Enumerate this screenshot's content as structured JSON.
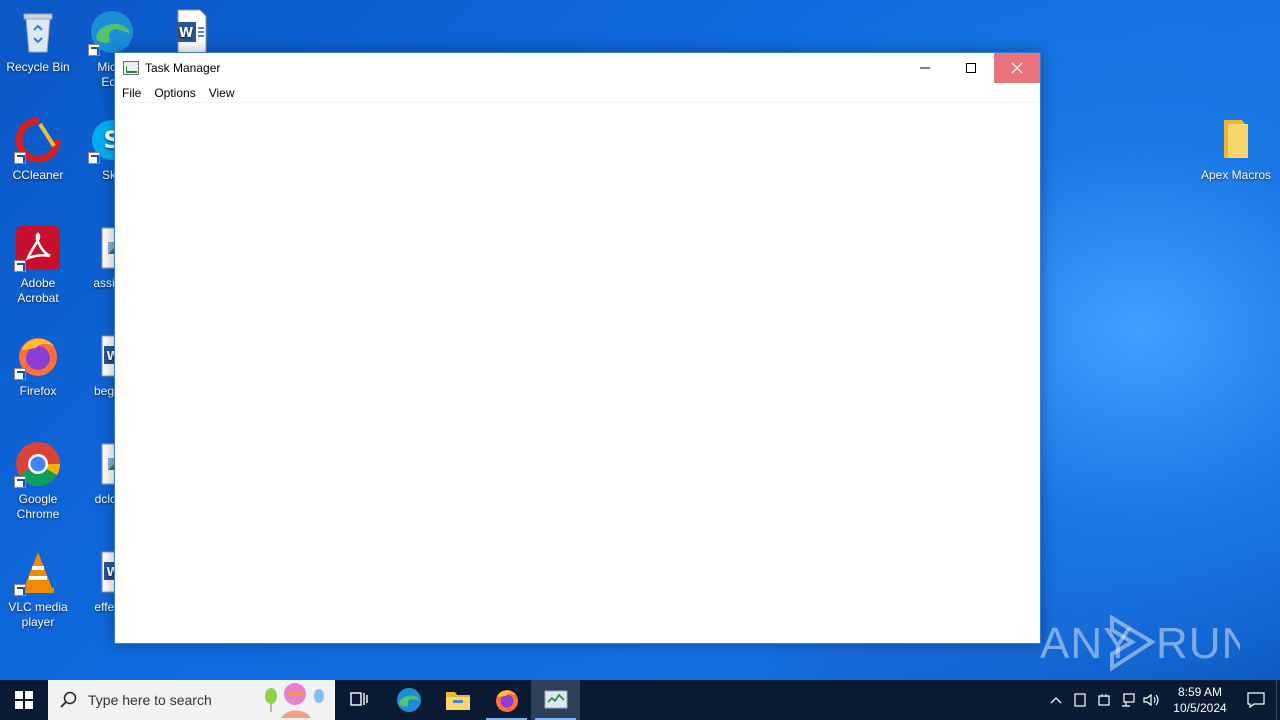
{
  "desktop": {
    "icons": [
      {
        "label": "Recycle Bin"
      },
      {
        "label": "Microsoft Edge",
        "visible_label": "Micro\nEdg"
      },
      {
        "label": "Word"
      },
      {
        "label": "CCleaner"
      },
      {
        "label": "Skype",
        "visible_label": "Sky"
      },
      {
        "label": "Adobe Acrobat"
      },
      {
        "label": "assista"
      },
      {
        "label": "Firefox"
      },
      {
        "label": "beginn"
      },
      {
        "label": "Google Chrome"
      },
      {
        "label": "dclothi"
      },
      {
        "label": "VLC media player"
      },
      {
        "label": "effects"
      },
      {
        "label": "Apex Macros"
      }
    ]
  },
  "window": {
    "title": "Task Manager",
    "menu": [
      "File",
      "Options",
      "View"
    ]
  },
  "watermark": {
    "text": "ANY RUN"
  },
  "taskbar": {
    "search_placeholder": "Type here to search",
    "clock_time": "8:59 AM",
    "clock_date": "10/5/2024"
  },
  "colors": {
    "close_button": "#e8737a",
    "taskbar": "#0a1a33",
    "desktop": "#1670e2"
  }
}
